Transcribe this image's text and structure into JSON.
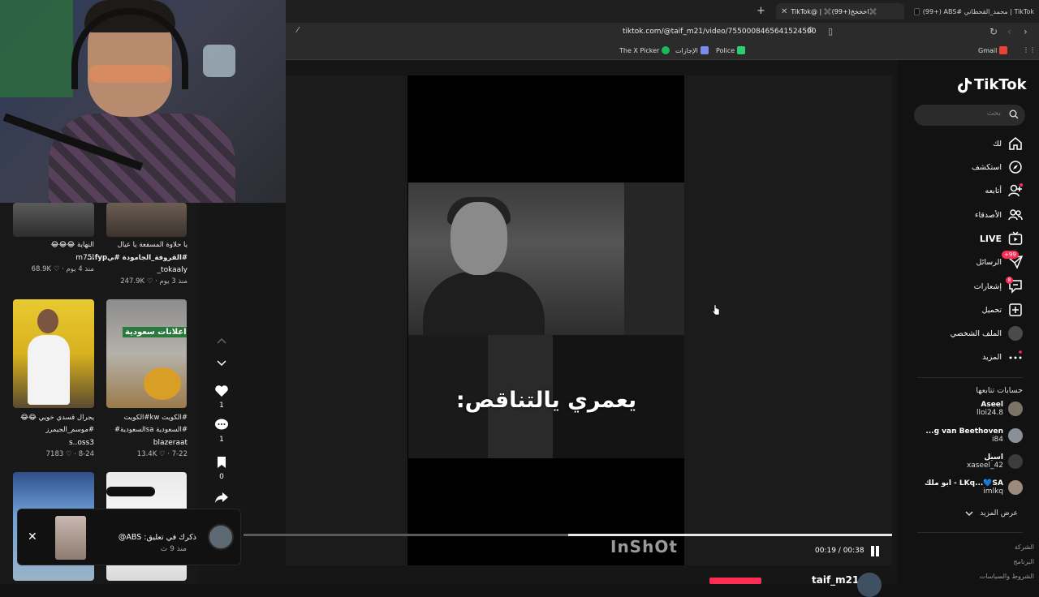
{
  "browser": {
    "tabs": [
      {
        "label": "(99+) ABS# محمد_القحطاني | TikTok"
      },
      {
        "label": "TikTok@ | ✖️(99+)اخخخخ✖️"
      }
    ],
    "url": "tiktok.com/@taif_m21/video/7550008465641524500",
    "bookmarks": [
      "Gmail",
      "Police",
      "الإجازات",
      "The X Picker"
    ]
  },
  "left_grid": {
    "items": [
      {
        "caption": "يا حلاوة المسفعة يا عيال",
        "caption2": "#القروفة_الجامودة #ﻲfyp...",
        "user": "_tokaaly",
        "meta": "247.9K ♡ · منذ 3 يوم"
      },
      {
        "caption": "النهاية 😂😂😂",
        "caption2": "",
        "user": "m75l",
        "meta": "68.9K ♡ · منذ 4 يوم"
      },
      {
        "caption": "#الكويت kw#الكويت",
        "caption2": "#السعودية saالسعودية#",
        "user": "blazeraat",
        "meta": "13.4K ♡ · 7-22",
        "thumb_text": "اعلانات سعودية"
      },
      {
        "caption": "يجرال قسدي خويي 😂😂",
        "caption2": "#موسم_الجيمرز",
        "user": "s..oss3",
        "meta": "7183 ♡ · 8-24"
      },
      {
        "caption": "",
        "caption2": "",
        "user": "",
        "meta": ""
      },
      {
        "caption": "",
        "caption2": "",
        "user": "",
        "meta": ""
      }
    ]
  },
  "actions": {
    "likes": "1",
    "comments": "1",
    "saves": "0"
  },
  "video": {
    "overlay_text": "يعمري يالتناقص:",
    "watermark": "InShOt",
    "time": "00:19 / 00:38",
    "progress": 0.5
  },
  "toast": {
    "title": "ذكرك في تعليق: ABS@",
    "time": "منذ 9 ث"
  },
  "sidebar": {
    "logo": "TikTok",
    "search_placeholder": "بحث",
    "nav": [
      {
        "label": "لك",
        "icon": "home-icon"
      },
      {
        "label": "استكشف",
        "icon": "compass-icon"
      },
      {
        "label": "أتابعه",
        "icon": "user-plus-icon"
      },
      {
        "label": "الأصدقاء",
        "icon": "friends-icon"
      },
      {
        "label": "LIVE",
        "icon": "live-icon"
      },
      {
        "label": "الرسائل",
        "icon": "messages-icon",
        "badge": "99+"
      },
      {
        "label": "إشعارات",
        "icon": "notifications-icon",
        "badge": "8"
      },
      {
        "label": "تحميل",
        "icon": "upload-icon"
      },
      {
        "label": "الملف الشخصي",
        "icon": "profile-icon"
      },
      {
        "label": "المزيد",
        "icon": "more-icon"
      }
    ],
    "following_title": "حسابات تتابعها",
    "following": [
      {
        "name": "Aseel",
        "handle": "lloi24.8"
      },
      {
        "name": "...g van Beethoven",
        "handle": "i84"
      },
      {
        "name": "اسيل",
        "handle": "xaseel_42"
      },
      {
        "name": "ابو ملك - LKq...💙SA",
        "handle": "imlkq"
      }
    ],
    "see_more": "عرض المزيد",
    "footer": [
      "الشركة",
      "البرنامج",
      "الشروط والسياسات"
    ]
  },
  "author": {
    "name": "taif_m21"
  },
  "colors": {
    "accent": "#fe2c55",
    "background": "#121212"
  }
}
